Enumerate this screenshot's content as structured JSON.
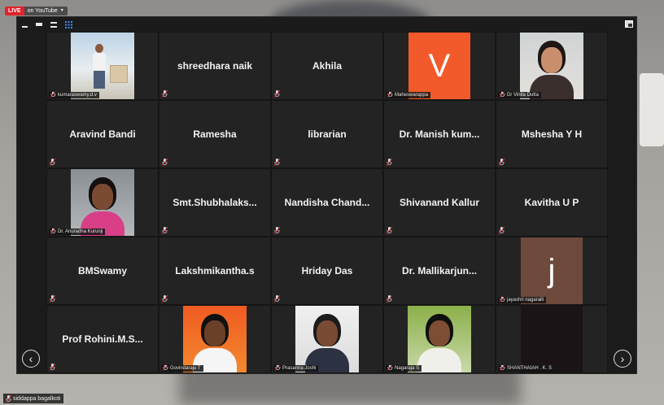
{
  "stream": {
    "live_label": "LIVE",
    "platform_label": "on YouTube"
  },
  "colors": {
    "live_red": "#e0232b",
    "mic_muted": "#e0343b",
    "tile_bg": "#232323",
    "accent_orange": "#f25a2b",
    "accent_brown": "#6e4a3c"
  },
  "participants": [
    {
      "name": "kumaraswamy.d.v",
      "kind": "video"
    },
    {
      "name": "shreedhara naik",
      "kind": "name"
    },
    {
      "name": "Akhila",
      "kind": "name"
    },
    {
      "name": "Maheswarappa",
      "kind": "letter",
      "letter": "V",
      "color": "#f25a2b"
    },
    {
      "name": "Dr Vinita Dutta",
      "kind": "video"
    },
    {
      "name": "Aravind Bandi",
      "kind": "name"
    },
    {
      "name": "Ramesha",
      "kind": "name"
    },
    {
      "name": "librarian",
      "kind": "name"
    },
    {
      "name": "Dr. Manish kum...",
      "kind": "name"
    },
    {
      "name": "Mshesha Y H",
      "kind": "name"
    },
    {
      "name": "Dr. Anuradha Kurunji",
      "kind": "video"
    },
    {
      "name": "Smt.Shubhalaks...",
      "kind": "name"
    },
    {
      "name": "Nandisha Chand...",
      "kind": "name"
    },
    {
      "name": "Shivanand Kallur",
      "kind": "name"
    },
    {
      "name": "Kavitha U P",
      "kind": "name"
    },
    {
      "name": "BMSwamy",
      "kind": "name"
    },
    {
      "name": "Lakshmikantha.s",
      "kind": "name"
    },
    {
      "name": "Hriday Das",
      "kind": "name"
    },
    {
      "name": "Dr. Mallikarjun...",
      "kind": "name"
    },
    {
      "name": "jayashri nagaralli",
      "kind": "letter",
      "letter": "j",
      "color": "#6e4a3c"
    },
    {
      "name": "Prof Rohini.M.S...",
      "kind": "name"
    },
    {
      "name": "Govindaraju T",
      "kind": "video"
    },
    {
      "name": "Prasanna Joshi",
      "kind": "video"
    },
    {
      "name": "Nagaraja S",
      "kind": "video"
    },
    {
      "name": "SHANTHAIAH . K. S",
      "kind": "video-dark"
    }
  ],
  "host": {
    "name": "siddappa bagalkoti"
  },
  "nav": {
    "prev": "‹",
    "next": "›"
  }
}
